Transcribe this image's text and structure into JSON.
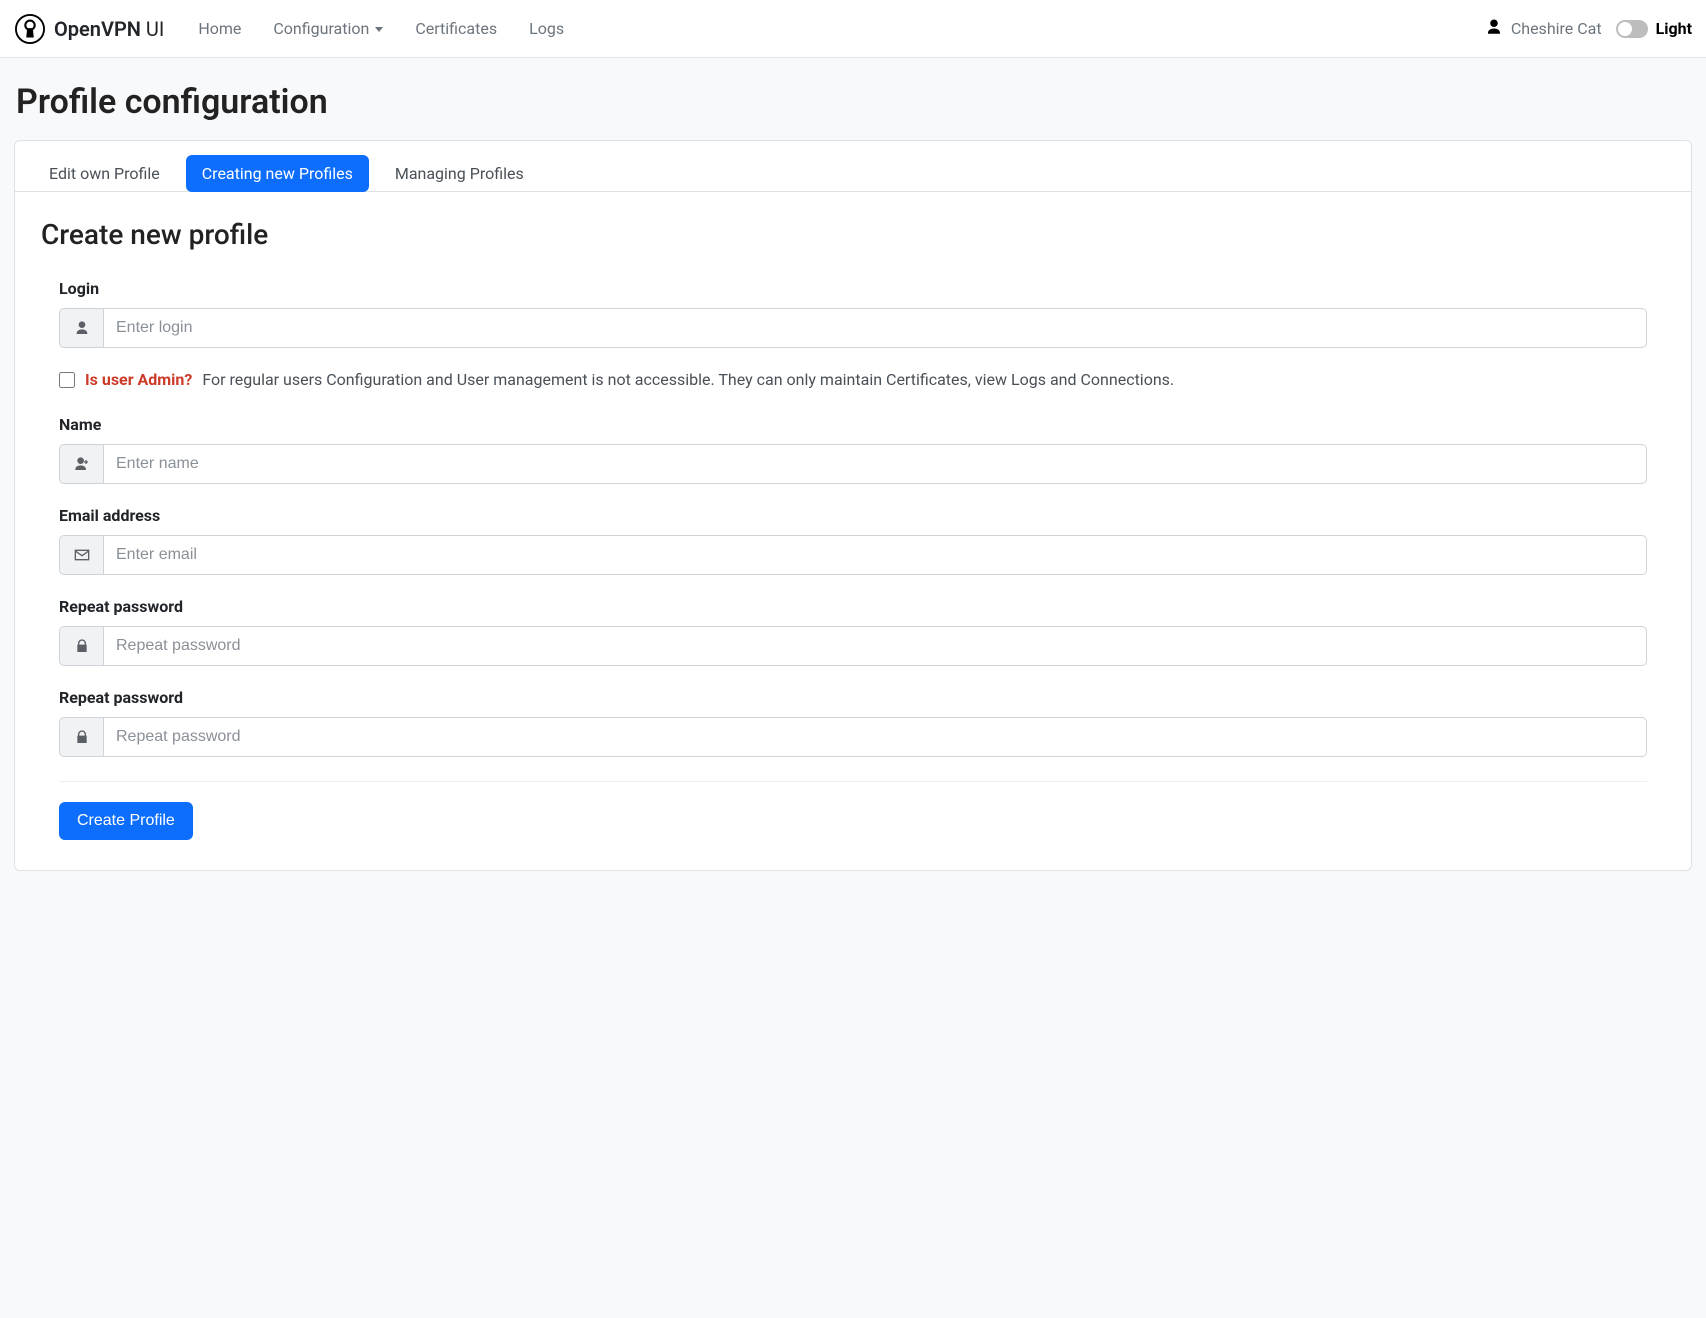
{
  "brand": {
    "strong": "OpenVPN",
    "light": " UI"
  },
  "nav": {
    "home": "Home",
    "configuration": "Configuration",
    "certificates": "Certificates",
    "logs": "Logs"
  },
  "user": {
    "name": "Cheshire Cat"
  },
  "theme": {
    "label": "Light"
  },
  "page": {
    "title": "Profile configuration",
    "tabs": {
      "edit": "Edit own Profile",
      "create": "Creating new Profiles",
      "manage": "Managing Profiles"
    },
    "section_title": "Create new profile"
  },
  "form": {
    "login": {
      "label": "Login",
      "placeholder": "Enter login",
      "value": ""
    },
    "is_admin": {
      "label": "Is user Admin?",
      "hint": "For regular users Configuration and User management is not accessible. They can only maintain Certificates, view Logs and Connections.",
      "checked": false
    },
    "name": {
      "label": "Name",
      "placeholder": "Enter name",
      "value": ""
    },
    "email": {
      "label": "Email address",
      "placeholder": "Enter email",
      "value": ""
    },
    "password1": {
      "label": "Repeat password",
      "placeholder": "Repeat password",
      "value": ""
    },
    "password2": {
      "label": "Repeat password",
      "placeholder": "Repeat password",
      "value": ""
    },
    "submit": "Create Profile"
  }
}
